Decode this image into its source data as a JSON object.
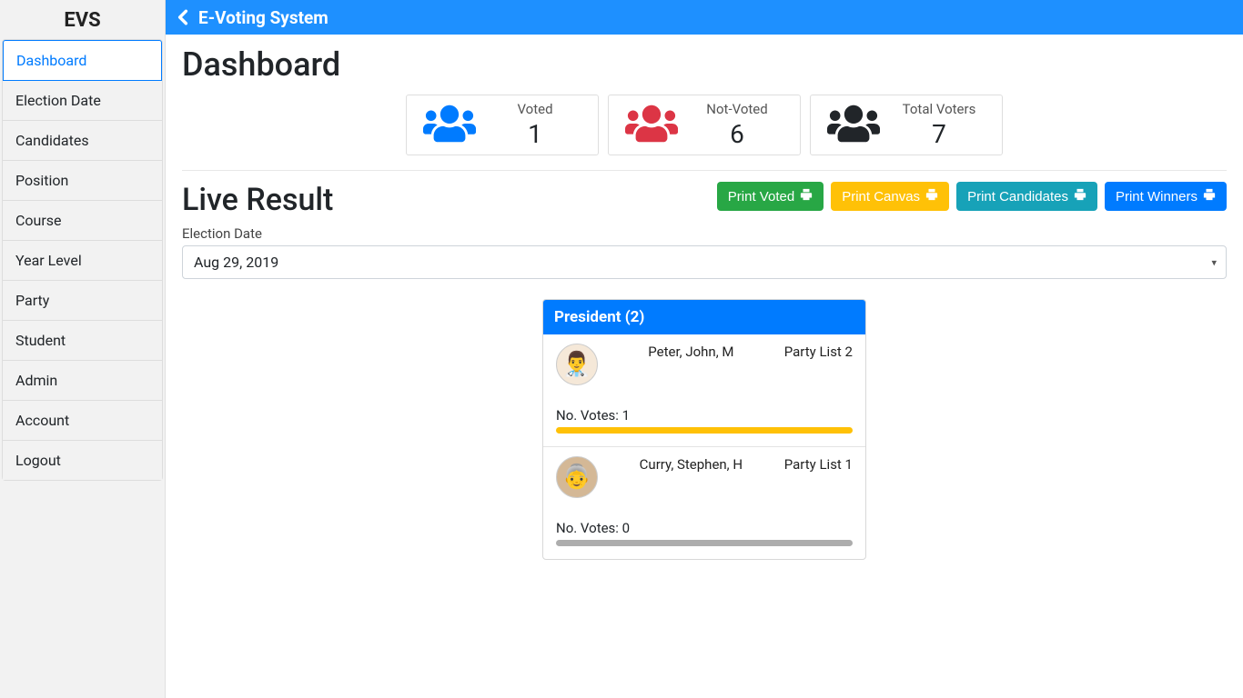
{
  "brand": "EVS",
  "header_title": "E-Voting System",
  "sidebar": {
    "items": [
      {
        "label": "Dashboard",
        "active": true
      },
      {
        "label": "Election Date"
      },
      {
        "label": "Candidates"
      },
      {
        "label": "Position"
      },
      {
        "label": "Course"
      },
      {
        "label": "Year Level"
      },
      {
        "label": "Party"
      },
      {
        "label": "Student"
      },
      {
        "label": "Admin"
      },
      {
        "label": "Account"
      },
      {
        "label": "Logout"
      }
    ]
  },
  "page_title": "Dashboard",
  "summary": [
    {
      "label": "Voted",
      "value": "1",
      "color": "#007bff"
    },
    {
      "label": "Not-Voted",
      "value": "6",
      "color": "#dc3545"
    },
    {
      "label": "Total Voters",
      "value": "7",
      "color": "#212529"
    }
  ],
  "live_result": {
    "title": "Live Result",
    "date_label": "Election Date",
    "date_value": "Aug 29, 2019"
  },
  "print_buttons": {
    "voted": "Print Voted",
    "canvas": "Print Canvas",
    "candidates": "Print Candidates",
    "winners": "Print Winners"
  },
  "position": {
    "header": "President (2)",
    "candidates": [
      {
        "name": "Peter, John, M",
        "party": "Party List 2",
        "votes_label": "No. Votes: 1",
        "bar_class": "fill-yellow",
        "avatar_bg": "#f5e8d8",
        "avatar_emoji": "👨‍⚕️"
      },
      {
        "name": "Curry, Stephen, H",
        "party": "Party List 1",
        "votes_label": "No. Votes: 0",
        "bar_class": "fill-gray",
        "avatar_bg": "#d4b896",
        "avatar_emoji": "👵"
      }
    ]
  }
}
